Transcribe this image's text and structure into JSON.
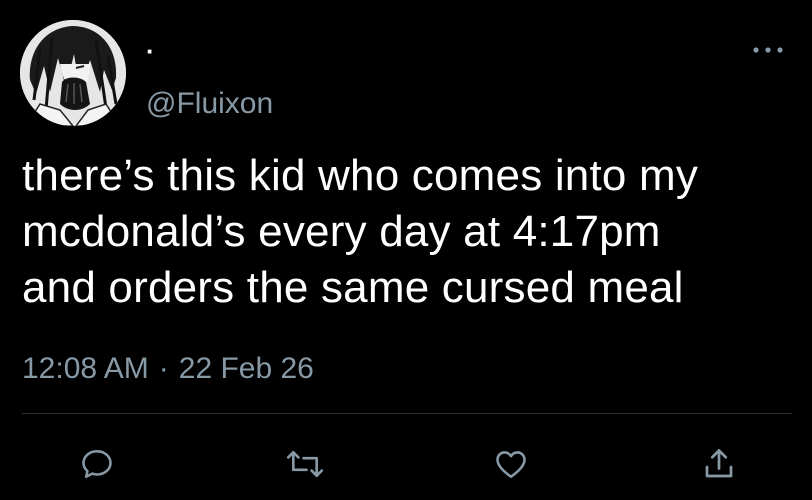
{
  "tweet": {
    "display_name": "·",
    "handle": "@Fluixon",
    "text": "there’s this kid who comes into my\nmcdonald’s every day at 4:17pm\nand orders the same cursed meal",
    "time": "12:08 AM",
    "separator": "·",
    "date": "22 Feb 26"
  },
  "colors": {
    "background": "#000000",
    "text": "#ffffff",
    "secondary_text": "#8899a6",
    "divider": "#2f3336"
  },
  "icons": {
    "more": "more-horizontal-icon",
    "reply": "speech-bubble-icon",
    "retweet": "retweet-arrows-icon",
    "like": "heart-icon",
    "share": "share-upload-icon"
  }
}
